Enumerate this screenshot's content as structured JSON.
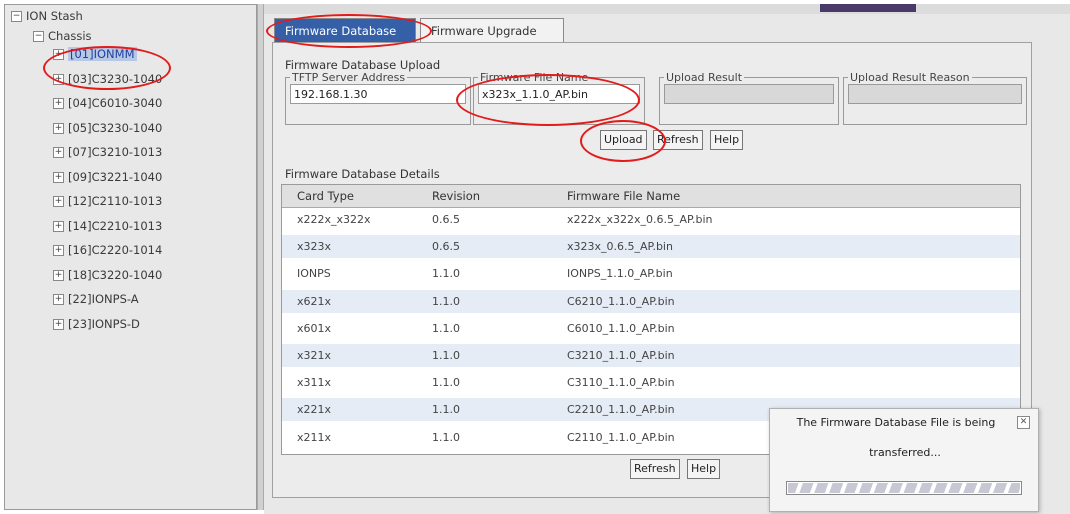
{
  "tree": {
    "root": "ION Stash",
    "chassis": "Chassis",
    "nodes": [
      "[01]IONMM",
      "[03]C3230-1040",
      "[04]C6010-3040",
      "[05]C3230-1040",
      "[07]C3210-1013",
      "[09]C3221-1040",
      "[12]C2110-1013",
      "[14]C2210-1013",
      "[16]C2220-1014",
      "[18]C3220-1040",
      "[22]IONPS-A",
      "[23]IONPS-D"
    ],
    "selected_index": 0
  },
  "tabs": [
    {
      "label": "Firmware Database",
      "active": true
    },
    {
      "label": "Firmware Upgrade",
      "active": false
    }
  ],
  "upload": {
    "section_title": "Firmware Database Upload",
    "tftp_label": "TFTP Server Address",
    "tftp_value": "192.168.1.30",
    "file_label": "Firmware File Name",
    "file_value": "x323x_1.1.0_AP.bin",
    "result_label": "Upload Result",
    "result_value": "",
    "reason_label": "Upload Result Reason",
    "reason_value": "",
    "upload_btn": "Upload",
    "refresh_btn": "Refresh",
    "help_btn": "Help"
  },
  "details": {
    "section_title": "Firmware Database Details",
    "columns": [
      "Card Type",
      "Revision",
      "Firmware File Name"
    ],
    "rows": [
      [
        "x222x_x322x",
        "0.6.5",
        "x222x_x322x_0.6.5_AP.bin"
      ],
      [
        "x323x",
        "0.6.5",
        "x323x_0.6.5_AP.bin"
      ],
      [
        "IONPS",
        "1.1.0",
        "IONPS_1.1.0_AP.bin"
      ],
      [
        "x621x",
        "1.1.0",
        "C6210_1.1.0_AP.bin"
      ],
      [
        "x601x",
        "1.1.0",
        "C6010_1.1.0_AP.bin"
      ],
      [
        "x321x",
        "1.1.0",
        "C3210_1.1.0_AP.bin"
      ],
      [
        "x311x",
        "1.1.0",
        "C3110_1.1.0_AP.bin"
      ],
      [
        "x221x",
        "1.1.0",
        "C2210_1.1.0_AP.bin"
      ],
      [
        "x211x",
        "1.1.0",
        "C2110_1.1.0_AP.bin"
      ]
    ],
    "refresh_btn": "Refresh",
    "help_btn": "Help"
  },
  "dialog": {
    "line1": "The Firmware Database File is being",
    "line2": "transferred...",
    "progress": 1.0
  },
  "colors": {
    "accent": "#3560a8",
    "annotation": "#e21b1b"
  }
}
